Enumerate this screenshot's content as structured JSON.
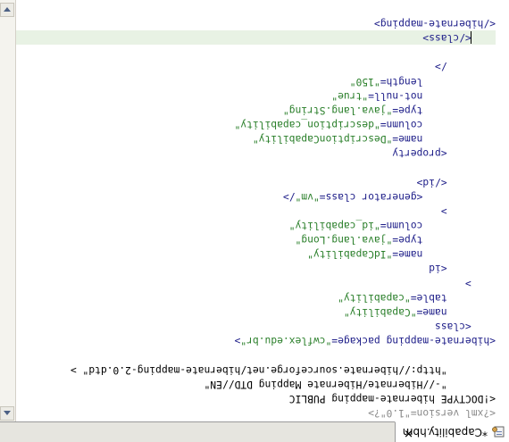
{
  "tab": {
    "label": "*Capability.hbm",
    "close_glyph": "✕",
    "icon": "xml-file-icon"
  },
  "editor": {
    "lines": [
      {
        "indent": "",
        "segments": [
          {
            "cls": "pi",
            "text": "<?xml version=\"1.0\"?>"
          }
        ]
      },
      {
        "indent": "",
        "segments": [
          {
            "cls": "doctype",
            "text": "<!DOCTYPE hibernate-mapping PUBLIC"
          }
        ]
      },
      {
        "indent": "        ",
        "segments": [
          {
            "cls": "doctype",
            "text": "\"-//Hibernate/Hibernate Mapping DTD//EN\""
          }
        ]
      },
      {
        "indent": "        ",
        "segments": [
          {
            "cls": "doctype",
            "text": "\"http://hibernate.sourceforge.net/hibernate-mapping-2.0.dtd\" >"
          }
        ]
      },
      {
        "indent": "",
        "segments": [
          {
            "cls": "doctype",
            "text": ""
          }
        ]
      },
      {
        "indent": "",
        "segments": [
          {
            "cls": "tag",
            "text": "<hibernate-mapping package="
          },
          {
            "cls": "str",
            "text": "\"cwflex.edu.br\""
          },
          {
            "cls": "tag",
            "text": ">"
          }
        ]
      },
      {
        "indent": "    ",
        "segments": [
          {
            "cls": "tag",
            "text": "<class"
          }
        ]
      },
      {
        "indent": "        ",
        "segments": [
          {
            "cls": "attr",
            "text": "name="
          },
          {
            "cls": "str",
            "text": "\"Capability\""
          }
        ]
      },
      {
        "indent": "        ",
        "segments": [
          {
            "cls": "attr",
            "text": "table="
          },
          {
            "cls": "str",
            "text": "\"capability\""
          }
        ]
      },
      {
        "indent": "    ",
        "segments": [
          {
            "cls": "tag",
            "text": ">"
          }
        ]
      },
      {
        "indent": "        ",
        "segments": [
          {
            "cls": "tag",
            "text": "<id"
          }
        ]
      },
      {
        "indent": "            ",
        "segments": [
          {
            "cls": "attr",
            "text": "name="
          },
          {
            "cls": "str",
            "text": "\"IdCapability\""
          }
        ]
      },
      {
        "indent": "            ",
        "segments": [
          {
            "cls": "attr",
            "text": "type="
          },
          {
            "cls": "str",
            "text": "\"java.lang.Long\""
          }
        ]
      },
      {
        "indent": "            ",
        "segments": [
          {
            "cls": "attr",
            "text": "column="
          },
          {
            "cls": "str",
            "text": "\"id_capability\""
          }
        ]
      },
      {
        "indent": "        ",
        "segments": [
          {
            "cls": "tag",
            "text": ">"
          }
        ]
      },
      {
        "indent": "            ",
        "segments": [
          {
            "cls": "tag",
            "text": "<generator class="
          },
          {
            "cls": "str",
            "text": "\"vm\""
          },
          {
            "cls": "tag",
            "text": "/>"
          }
        ]
      },
      {
        "indent": "        ",
        "segments": [
          {
            "cls": "tag",
            "text": "</id>"
          }
        ]
      },
      {
        "indent": "",
        "segments": [
          {
            "cls": "tag",
            "text": ""
          }
        ]
      },
      {
        "indent": "        ",
        "segments": [
          {
            "cls": "tag",
            "text": "<property"
          }
        ]
      },
      {
        "indent": "            ",
        "segments": [
          {
            "cls": "attr",
            "text": "name="
          },
          {
            "cls": "str",
            "text": "\"DescriptionCapability\""
          }
        ]
      },
      {
        "indent": "            ",
        "segments": [
          {
            "cls": "attr",
            "text": "column="
          },
          {
            "cls": "str",
            "text": "\"description_capability\""
          }
        ]
      },
      {
        "indent": "            ",
        "segments": [
          {
            "cls": "attr",
            "text": "type="
          },
          {
            "cls": "str",
            "text": "\"java.lang.String\""
          }
        ]
      },
      {
        "indent": "            ",
        "segments": [
          {
            "cls": "attr",
            "text": "not-null="
          },
          {
            "cls": "str",
            "text": "\"true\""
          }
        ]
      },
      {
        "indent": "            ",
        "segments": [
          {
            "cls": "attr",
            "text": "length="
          },
          {
            "cls": "str",
            "text": "\"150\""
          }
        ]
      },
      {
        "indent": "        ",
        "segments": [
          {
            "cls": "tag",
            "text": "/>"
          }
        ]
      },
      {
        "indent": "",
        "segments": [
          {
            "cls": "tag",
            "text": ""
          }
        ]
      },
      {
        "indent": "    ",
        "segments": [
          {
            "cls": "tag",
            "text": "</class>"
          }
        ]
      },
      {
        "indent": "",
        "segments": [
          {
            "cls": "tag",
            "text": "</hibernate-mapping>"
          }
        ]
      }
    ]
  },
  "colors": {
    "tag": "#20208a",
    "string": "#2a7f2a",
    "processing_instruction": "#8a8a8a",
    "current_line": "#e8f2e4"
  }
}
